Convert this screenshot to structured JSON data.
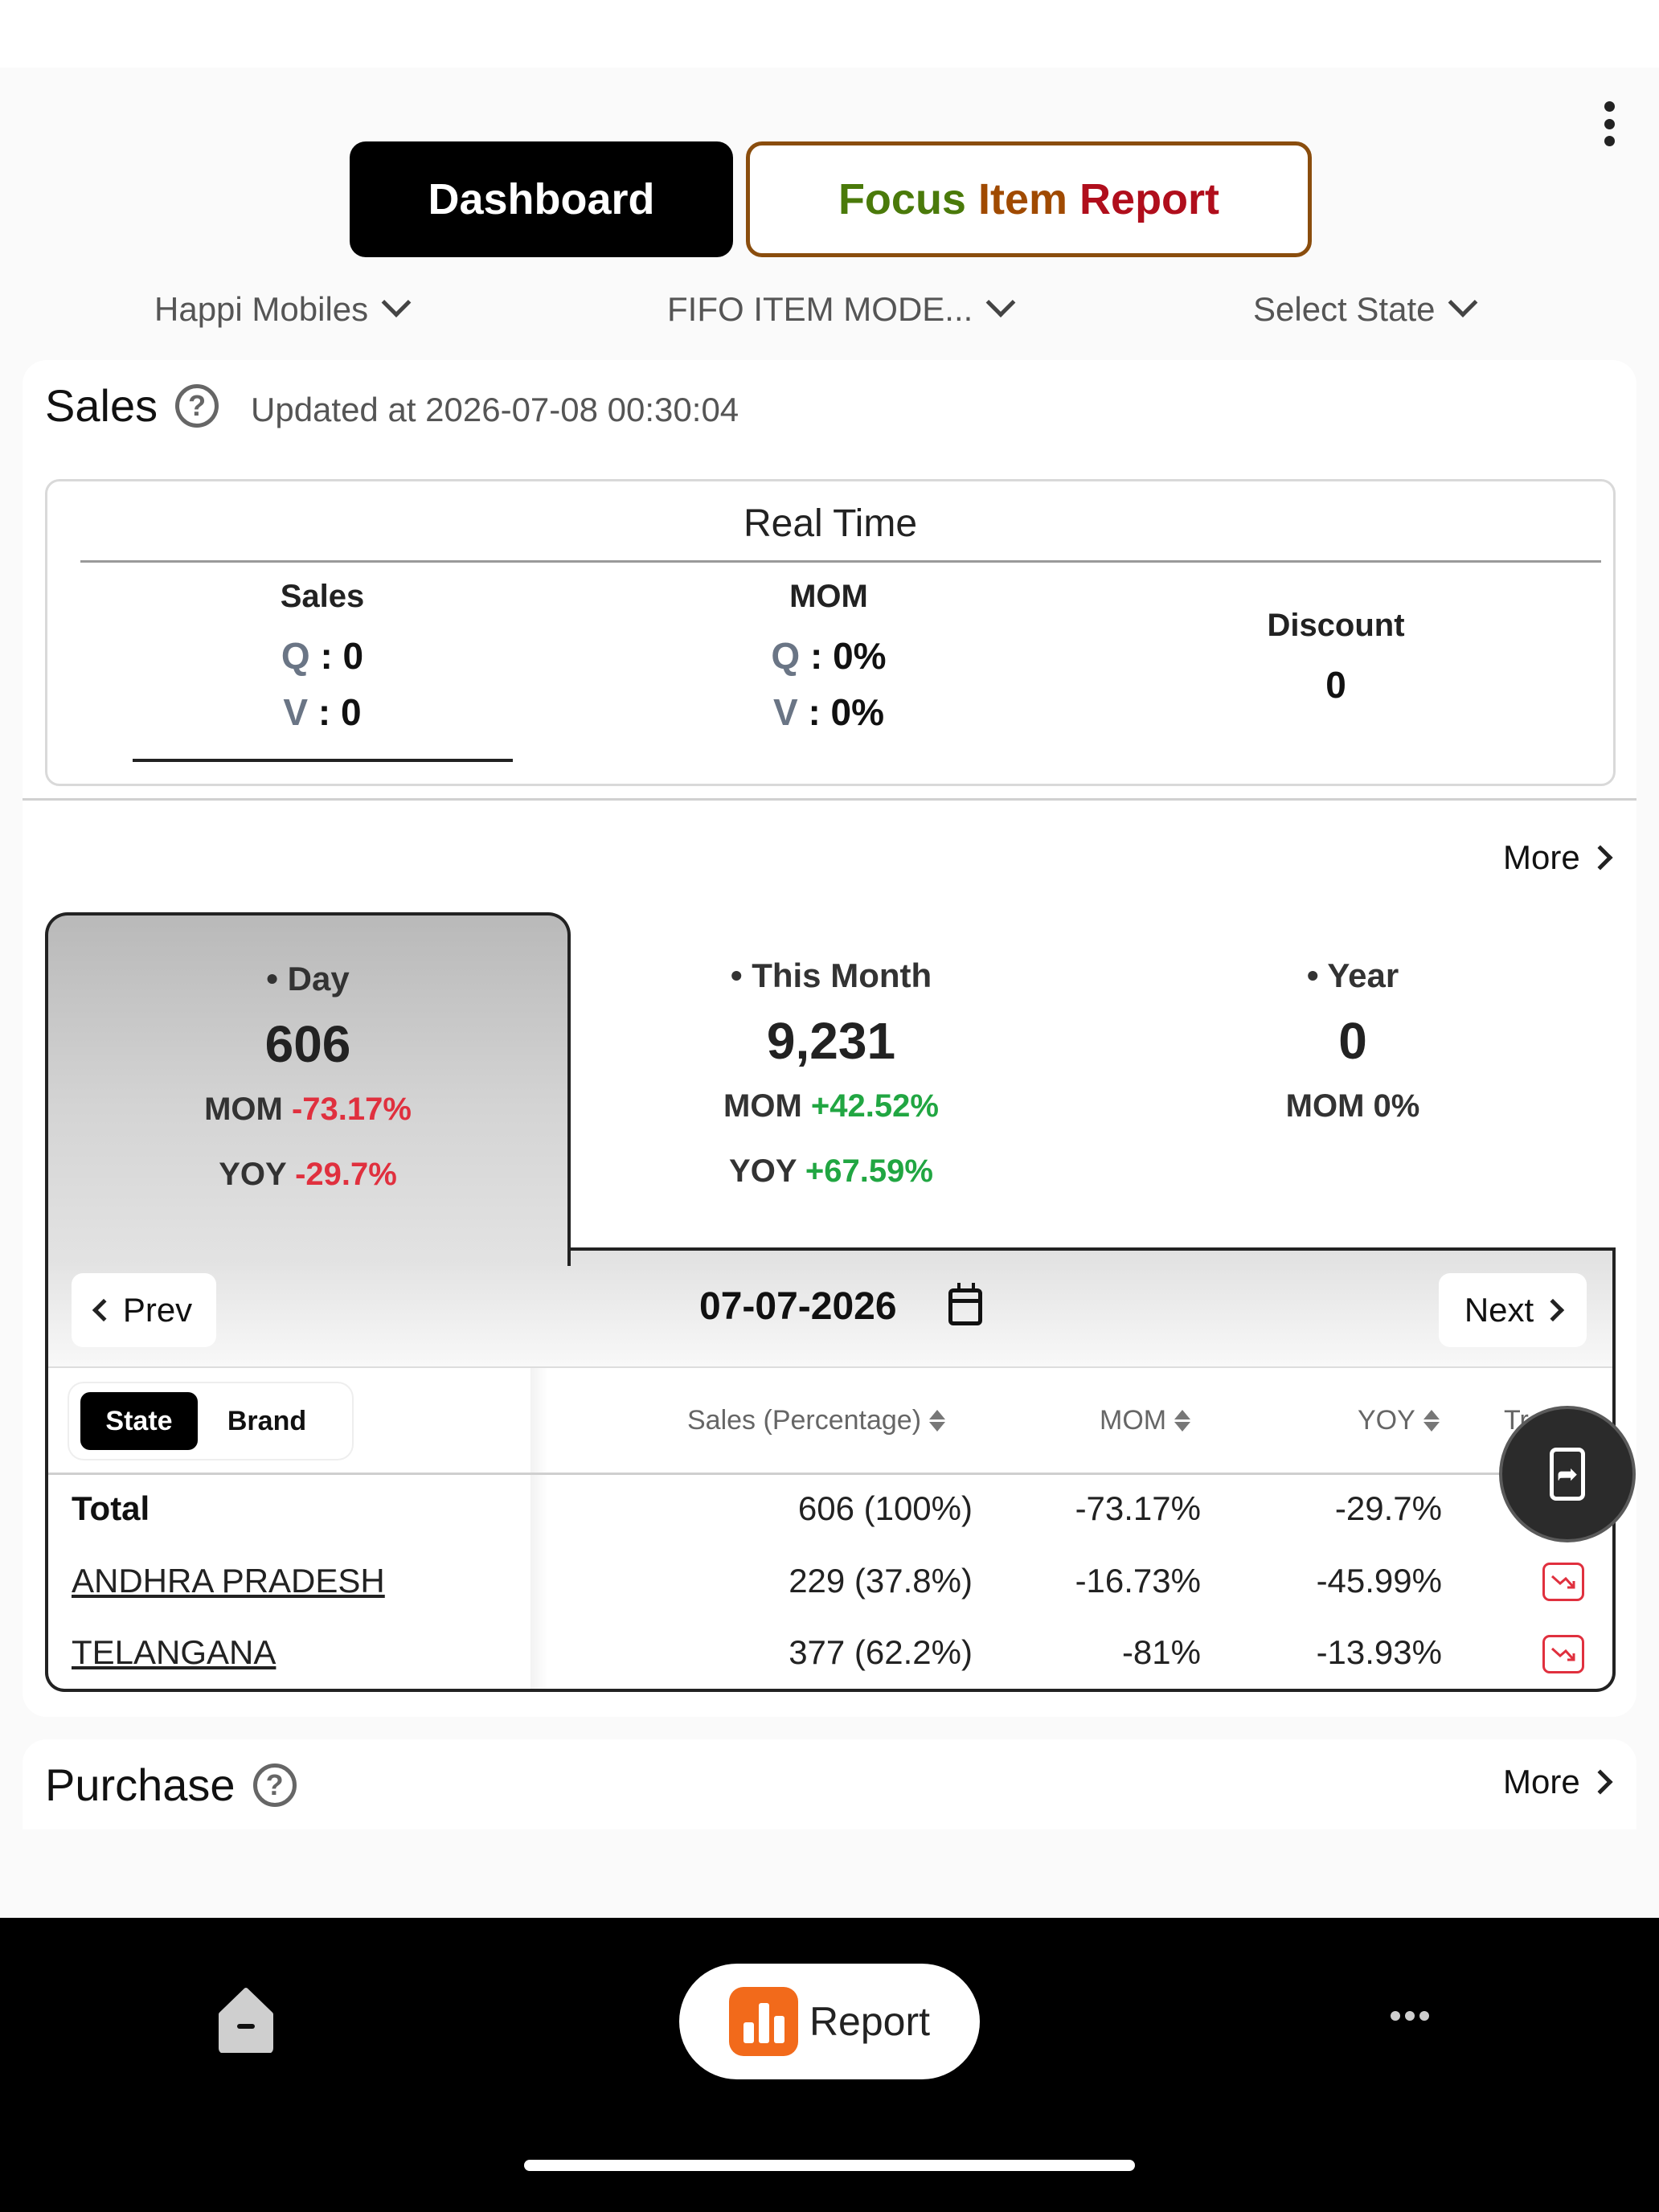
{
  "header": {
    "tabs": {
      "dashboard": "Dashboard",
      "focus_w1": "Focus",
      "focus_w2": "Item",
      "focus_w3": "Report"
    },
    "filters": {
      "company": "Happi Mobiles",
      "item": "FIFO ITEM MODE...",
      "state": "Select State"
    }
  },
  "sales": {
    "title": "Sales",
    "updated": "Updated at 2026-07-08 00:30:04",
    "realtime": {
      "title": "Real Time",
      "sales": {
        "head": "Sales",
        "q_label": "Q",
        "q_value": ": 0",
        "v_label": "V",
        "v_value": ": 0"
      },
      "mom": {
        "head": "MOM",
        "q_label": "Q",
        "q_value": ": 0%",
        "v_label": "V",
        "v_value": ": 0%"
      },
      "discount": {
        "head": "Discount",
        "value": "0"
      }
    },
    "more_label": "More",
    "periods": {
      "day": {
        "label": "• Day",
        "value": "606",
        "mom_label": "MOM",
        "mom": "-73.17%",
        "yoy_label": "YOY",
        "yoy": "-29.7%"
      },
      "month": {
        "label": "• This Month",
        "value": "9,231",
        "mom_label": "MOM",
        "mom": "+42.52%",
        "yoy_label": "YOY",
        "yoy": "+67.59%"
      },
      "year": {
        "label": "• Year",
        "value": "0",
        "mom_label": "MOM",
        "mom": "0%"
      }
    },
    "date_nav": {
      "prev": "Prev",
      "next": "Next",
      "date": "07-07-2026"
    },
    "table": {
      "segment": {
        "state": "State",
        "brand": "Brand"
      },
      "columns": {
        "sales": "Sales (Percentage)",
        "mom": "MOM",
        "yoy": "YOY",
        "trend": "Trend"
      },
      "rows": [
        {
          "name": "Total",
          "sales": "606 (100%)",
          "mom": "-73.17%",
          "yoy": "-29.7%"
        },
        {
          "name": "ANDHRA PRADESH",
          "sales": "229 (37.8%)",
          "mom": "-16.73%",
          "yoy": "-45.99%"
        },
        {
          "name": "TELANGANA",
          "sales": "377 (62.2%)",
          "mom": "-81%",
          "yoy": "-13.93%"
        }
      ]
    }
  },
  "purchase": {
    "title": "Purchase",
    "more_label": "More"
  },
  "bottom_nav": {
    "report_label": "Report"
  },
  "colors": {
    "negative": "#e0303e",
    "positive": "#21a642",
    "report_accent": "#f26a1b",
    "focus_border": "#8a4d0d"
  },
  "icons": [
    "kebab-menu-icon",
    "chevron-down-icon",
    "help-icon",
    "chevron-right-icon",
    "chevron-left-icon",
    "calendar-icon",
    "sort-icon",
    "trend-down-icon",
    "share-screen-icon",
    "home-icon",
    "report-chart-icon",
    "more-dots-icon"
  ]
}
